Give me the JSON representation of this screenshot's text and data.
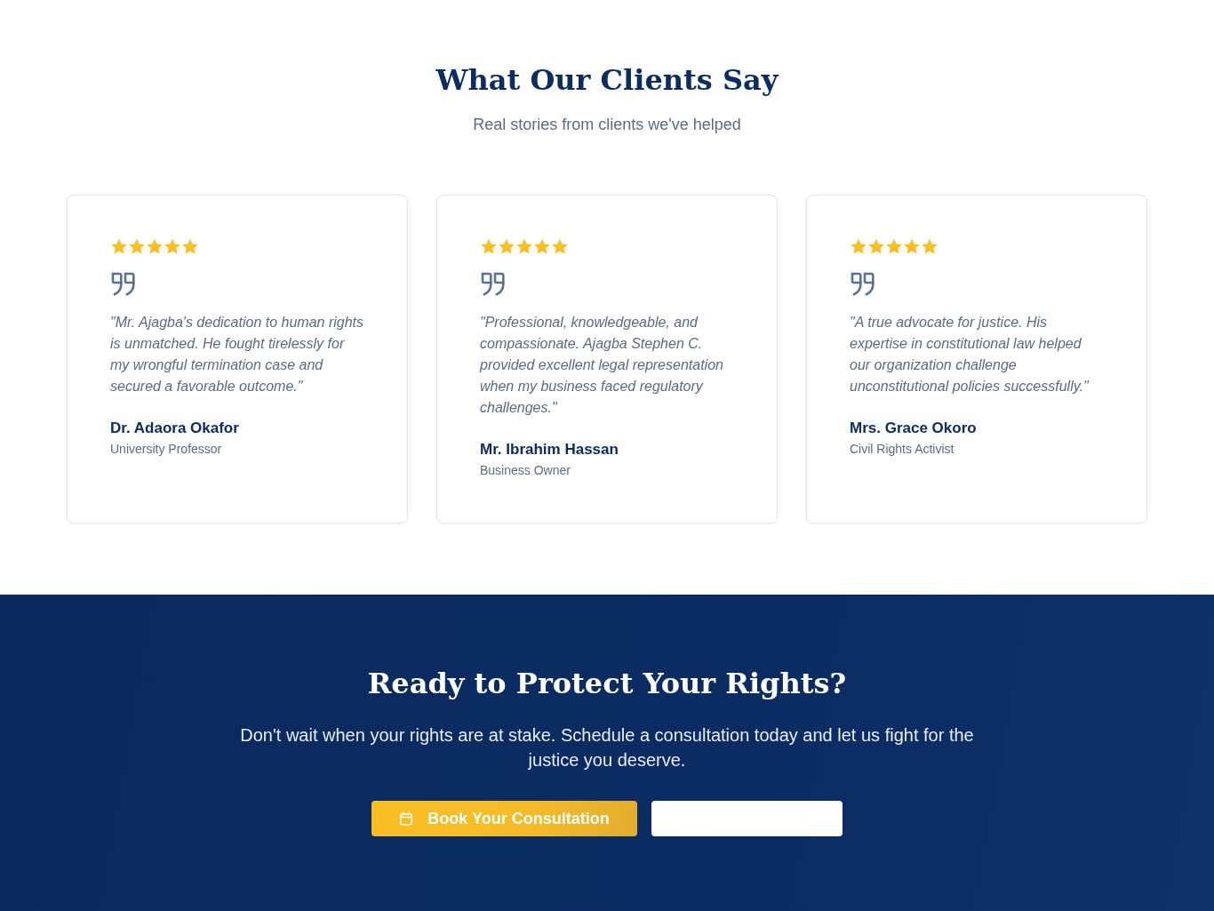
{
  "testimonials_section": {
    "title": "What Our Clients Say",
    "subtitle": "Real stories from clients we've helped"
  },
  "testimonials": [
    {
      "stars": 5,
      "quote": "\"Mr. Ajagba's dedication to human rights is unmatched. He fought tirelessly for my wrongful termination case and secured a favorable outcome.\"",
      "name": "Dr. Adaora Okafor",
      "role": "University Professor"
    },
    {
      "stars": 5,
      "quote": "\"Professional, knowledgeable, and compassionate. Ajagba Stephen C. provided excellent legal representation when my business faced regulatory challenges.\"",
      "name": "Mr. Ibrahim Hassan",
      "role": "Business Owner"
    },
    {
      "stars": 5,
      "quote": "\"A true advocate for justice. His expertise in constitutional law helped our organization challenge unconstitutional policies successfully.\"",
      "name": "Mrs. Grace Okoro",
      "role": "Civil Rights Activist"
    }
  ],
  "cta": {
    "title": "Ready to Protect Your Rights?",
    "text": "Don't wait when your rights are at stake. Schedule a consultation today and let us fight for the justice you deserve.",
    "buttons": [
      {
        "kind": "primary",
        "label": "Book Your Consultation"
      },
      {
        "kind": "secondary"
      }
    ]
  }
}
